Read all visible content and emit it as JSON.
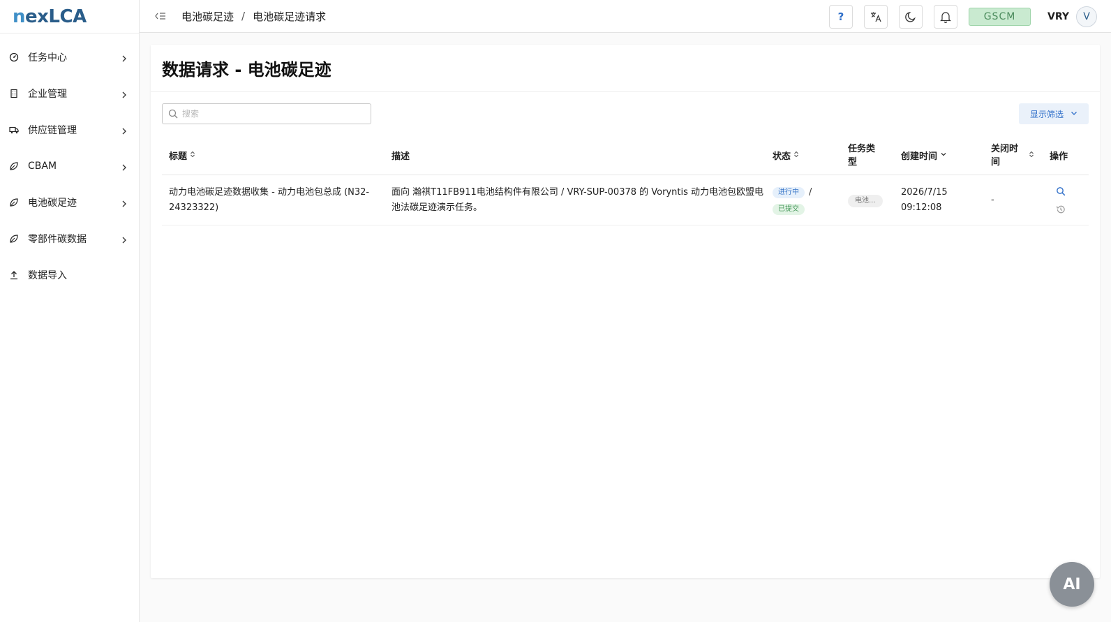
{
  "app": {
    "logo": "nexLCA",
    "logo_accent": "n",
    "logo_rest": "exLCA"
  },
  "sidebar": {
    "items": [
      {
        "label": "任务中心",
        "icon": "dashboard-icon"
      },
      {
        "label": "企业管理",
        "icon": "building-icon"
      },
      {
        "label": "供应链管理",
        "icon": "truck-icon"
      },
      {
        "label": "CBAM",
        "icon": "leaf-icon"
      },
      {
        "label": "电池碳足迹",
        "icon": "leaf-icon"
      },
      {
        "label": "零部件碳数据",
        "icon": "leaf-icon"
      },
      {
        "label": "数据导入",
        "icon": "upload-icon"
      }
    ]
  },
  "header": {
    "breadcrumb": [
      "电池碳足迹",
      "电池碳足迹请求"
    ],
    "breadcrumb_sep": "/",
    "help_label": "?",
    "tenant": "GSCM",
    "user": "VRY",
    "avatar_letter": "V"
  },
  "main": {
    "title": "数据请求 - 电池碳足迹",
    "search_placeholder": "搜索",
    "filter_label": "显示筛选",
    "columns": [
      "标题",
      "描述",
      "状态",
      "任务类型",
      "创建时间",
      "关闭时间",
      "操作"
    ],
    "rows": [
      {
        "title": "动力电池碳足迹数据收集 - 动力电池包总成 (N32-24323322)",
        "description": "面向 瀚祺T11FB911电池结构件有限公司 / VRY-SUP-00378 的 Voryntis 动力电池包欧盟电池法碳足迹演示任务。",
        "status_primary": "进行中",
        "status_sep": "/",
        "status_secondary": "已提交",
        "task_type": "电池...",
        "created": "2026/7/15 09:12:08",
        "closed": "-"
      }
    ]
  },
  "ai_button": "AI",
  "colors": {
    "accent": "#2f6fc9",
    "success": "#4b9a5e",
    "tenant_bg": "#c9ead0"
  }
}
